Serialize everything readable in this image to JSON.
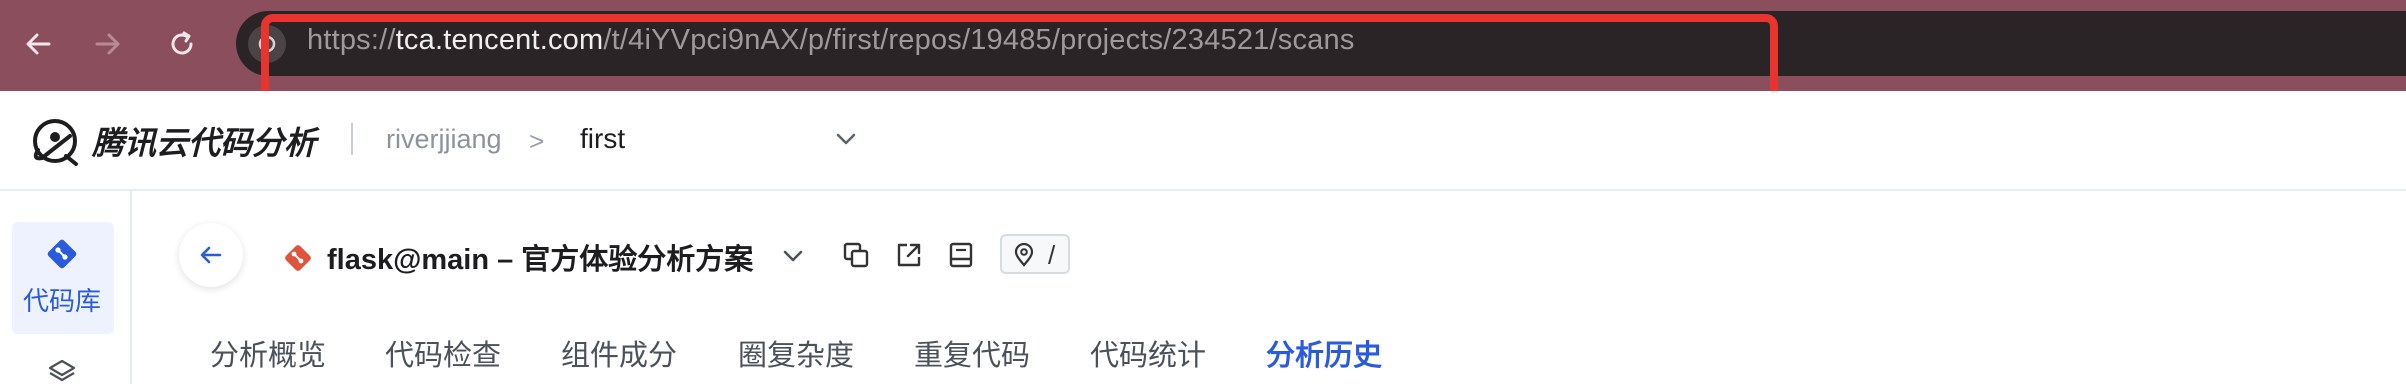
{
  "browser": {
    "url_prefix": "https://",
    "url_host": "tca.tencent.com",
    "url_path": "/t/4iYVpci9nAX/p/first/repos/19485/projects/234521/scans",
    "colors": {
      "chrome_bg": "#8a4e5c",
      "omnibox_bg": "#2a2426",
      "highlight_box": "#e8332e"
    },
    "icons": [
      "back-arrow-icon",
      "forward-arrow-icon",
      "reload-icon",
      "site-info-icon"
    ]
  },
  "header": {
    "brand": "腾讯云代码分析",
    "breadcrumb_user": "riverjjiang",
    "breadcrumb_separator": ">",
    "breadcrumb_repo": "first"
  },
  "sidebar": {
    "items": [
      {
        "label": "代码库",
        "icon": "git-repo-icon",
        "active": true
      },
      {
        "label": "",
        "icon": "layers-icon",
        "active": false
      }
    ],
    "accent": "#2a5bdb"
  },
  "project": {
    "title": "flask@main – 官方体验分析方案",
    "path": "/"
  },
  "tabs": [
    {
      "label": "分析概览",
      "active": false
    },
    {
      "label": "代码检查",
      "active": false
    },
    {
      "label": "组件成分",
      "active": false
    },
    {
      "label": "圈复杂度",
      "active": false
    },
    {
      "label": "重复代码",
      "active": false
    },
    {
      "label": "代码统计",
      "active": false
    },
    {
      "label": "分析历史",
      "active": true
    }
  ]
}
